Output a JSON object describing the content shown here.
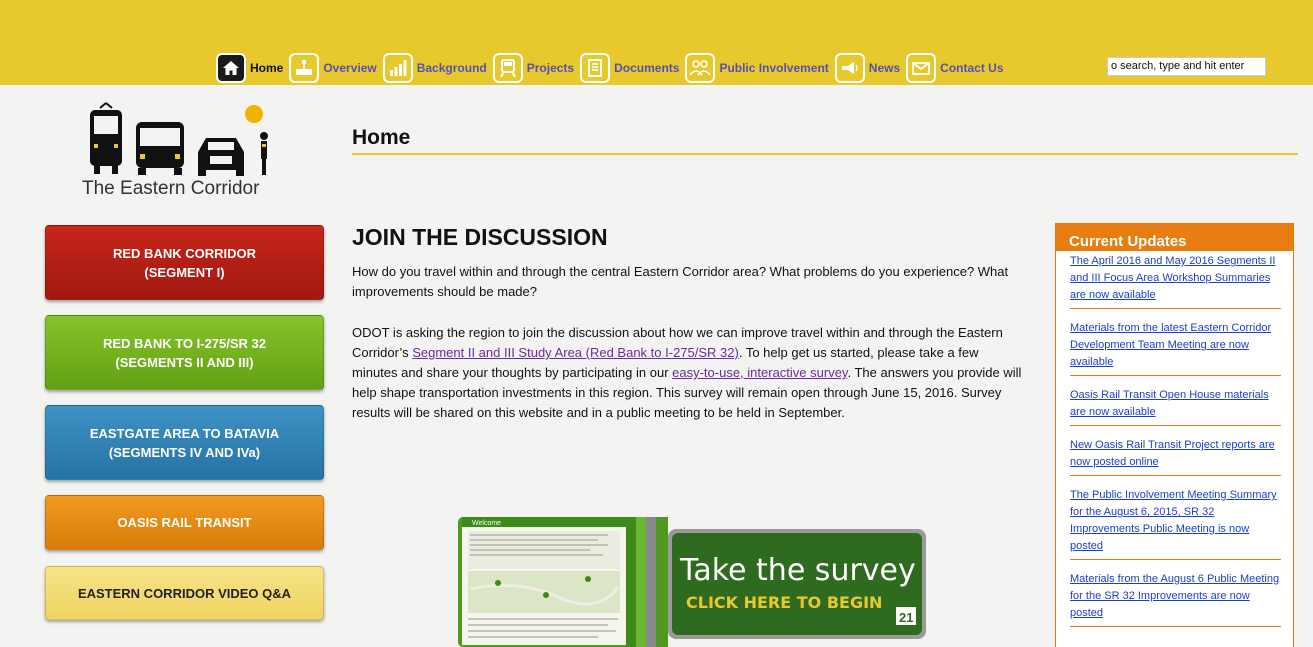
{
  "nav": {
    "items": [
      {
        "label": "Home",
        "icon": "home-icon"
      },
      {
        "label": "Overview",
        "icon": "overview-icon"
      },
      {
        "label": "Background",
        "icon": "bar-chart-icon"
      },
      {
        "label": "Projects",
        "icon": "train-icon"
      },
      {
        "label": "Documents",
        "icon": "document-icon"
      },
      {
        "label": "Public Involvement",
        "icon": "people-icon"
      },
      {
        "label": "News",
        "icon": "megaphone-icon"
      },
      {
        "label": "Contact Us",
        "icon": "envelope-icon"
      }
    ],
    "search_value": "o search, type and hit enter"
  },
  "logo": {
    "text": "The Eastern Corridor"
  },
  "page": {
    "title": "Home"
  },
  "sidebar": {
    "buttons": [
      {
        "line1": "RED BANK CORRIDOR",
        "line2": "(SEGMENT I)"
      },
      {
        "line1": "RED BANK TO I-275/SR 32",
        "line2": "(SEGMENTS II AND III)"
      },
      {
        "line1": "EASTGATE AREA TO BATAVIA",
        "line2": "(SEGMENTS IV AND IVa)"
      },
      {
        "line1": "OASIS RAIL TRANSIT"
      },
      {
        "line1": "EASTERN CORRIDOR VIDEO Q&A"
      }
    ]
  },
  "main": {
    "heading": "JOIN THE DISCUSSION",
    "para1": "How do you travel within and through the central Eastern Corridor area? What problems do you experience?  What improvements should be made?",
    "para2_a": "ODOT is asking the region to join the discussion about how we can improve travel within and through the Eastern Corridor’s ",
    "para2_link1": "Segment II and III Study Area (Red Bank to I-275/SR 32)",
    "para2_b": ".  To help get us started, please take a few minutes and share your thoughts by participating in our ",
    "para2_link2": "easy-to-use, interactive survey",
    "para2_c": ". The answers you provide will help shape transportation investments in this region. This survey will remain open through June 15, 2016. Survey results will be shared on this website and in a public meeting to be held in September.",
    "survey": {
      "line1": "Take the survey",
      "line2": "CLICK HERE TO BEGIN",
      "panel_label": "Welcome"
    }
  },
  "updates": {
    "title": "Current Updates",
    "items": [
      "The April 2016 and May 2016 Segments II and III Focus Area Workshop Summaries are now available",
      "Materials from the latest Eastern Corridor Development Team Meeting are now available",
      "Oasis Rail Transit Open House materials are now available",
      "New Oasis Rail Transit Project reports are now posted online",
      "The Public Involvement Meeting Summary for the August 6, 2015, SR 32 Improvements Public Meeting is now posted",
      "Materials from the August 6 Public Meeting for the SR 32 Improvements are now posted"
    ]
  },
  "colors": {
    "top_bar": "#e8c92d",
    "accent_orange": "#e87d12",
    "nav_link": "#5a4fb0",
    "link_blue": "#1a3fcc"
  }
}
